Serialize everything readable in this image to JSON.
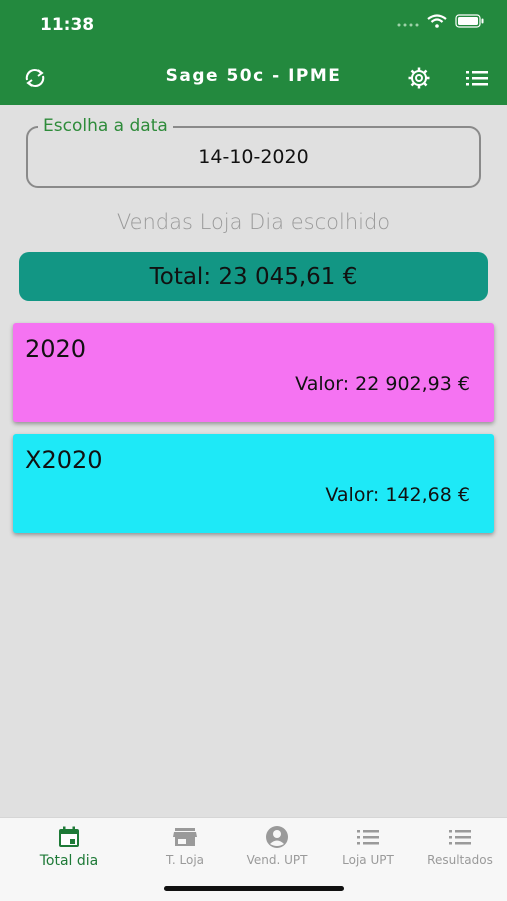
{
  "status_bar": {
    "time": "11:38"
  },
  "appbar": {
    "title": "Sage 50c - IPME",
    "refresh_icon": "refresh-icon",
    "settings_icon": "gear-icon",
    "menu_icon": "list-icon"
  },
  "date_picker": {
    "label": "Escolha a data",
    "value": "14-10-2020"
  },
  "subtitle": "Vendas Loja Dia escolhido",
  "total": {
    "text": "Total: 23 045,61 €"
  },
  "cards": [
    {
      "title": "2020",
      "value": "Valor: 22 902,93 €",
      "color": "#f573f2"
    },
    {
      "title": "X2020",
      "value": "Valor: 142,68 €",
      "color": "#1ee9f7"
    }
  ],
  "tabs": [
    {
      "label": "Total dia",
      "icon": "calendar-icon",
      "active": true
    },
    {
      "label": "T. Loja",
      "icon": "store-icon",
      "active": false
    },
    {
      "label": "Vend. UPT",
      "icon": "account-icon",
      "active": false
    },
    {
      "label": "Loja UPT",
      "icon": "list-icon",
      "active": false
    },
    {
      "label": "Resultados",
      "icon": "list-icon",
      "active": false
    }
  ],
  "colors": {
    "primary": "#23893e",
    "total_bg": "#129684",
    "accent_text": "#2e8b3a"
  }
}
